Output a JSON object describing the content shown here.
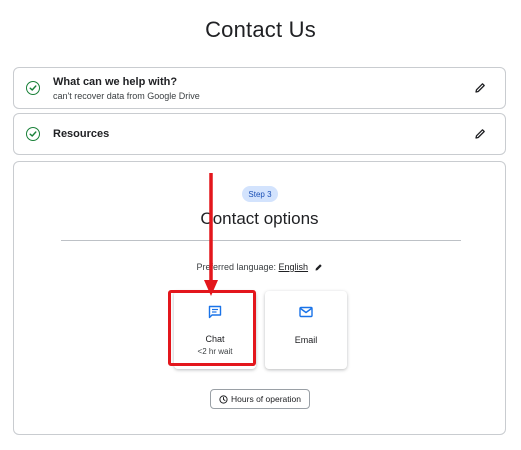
{
  "page": {
    "title": "Contact Us"
  },
  "sections": {
    "help": {
      "title": "What can we help with?",
      "subtitle": "can't recover data from Google Drive",
      "icon": "check-circle-icon",
      "edit_icon": "pencil-icon"
    },
    "resources": {
      "title": "Resources",
      "icon": "check-circle-icon",
      "edit_icon": "pencil-icon"
    }
  },
  "contact": {
    "step_label": "Step 3",
    "title": "Contact options",
    "language_label": "Preferred language:",
    "language_value": "English",
    "options": [
      {
        "icon": "chat-icon",
        "label": "Chat",
        "wait": "<2 hr wait"
      },
      {
        "icon": "email-icon",
        "label": "Email"
      }
    ],
    "hours_label": "Hours of operation"
  },
  "colors": {
    "check_green": "#188038",
    "accent_blue": "#1a73e8",
    "step_pill_bg": "#d3e3fd",
    "annotation_red": "#e3161c"
  }
}
